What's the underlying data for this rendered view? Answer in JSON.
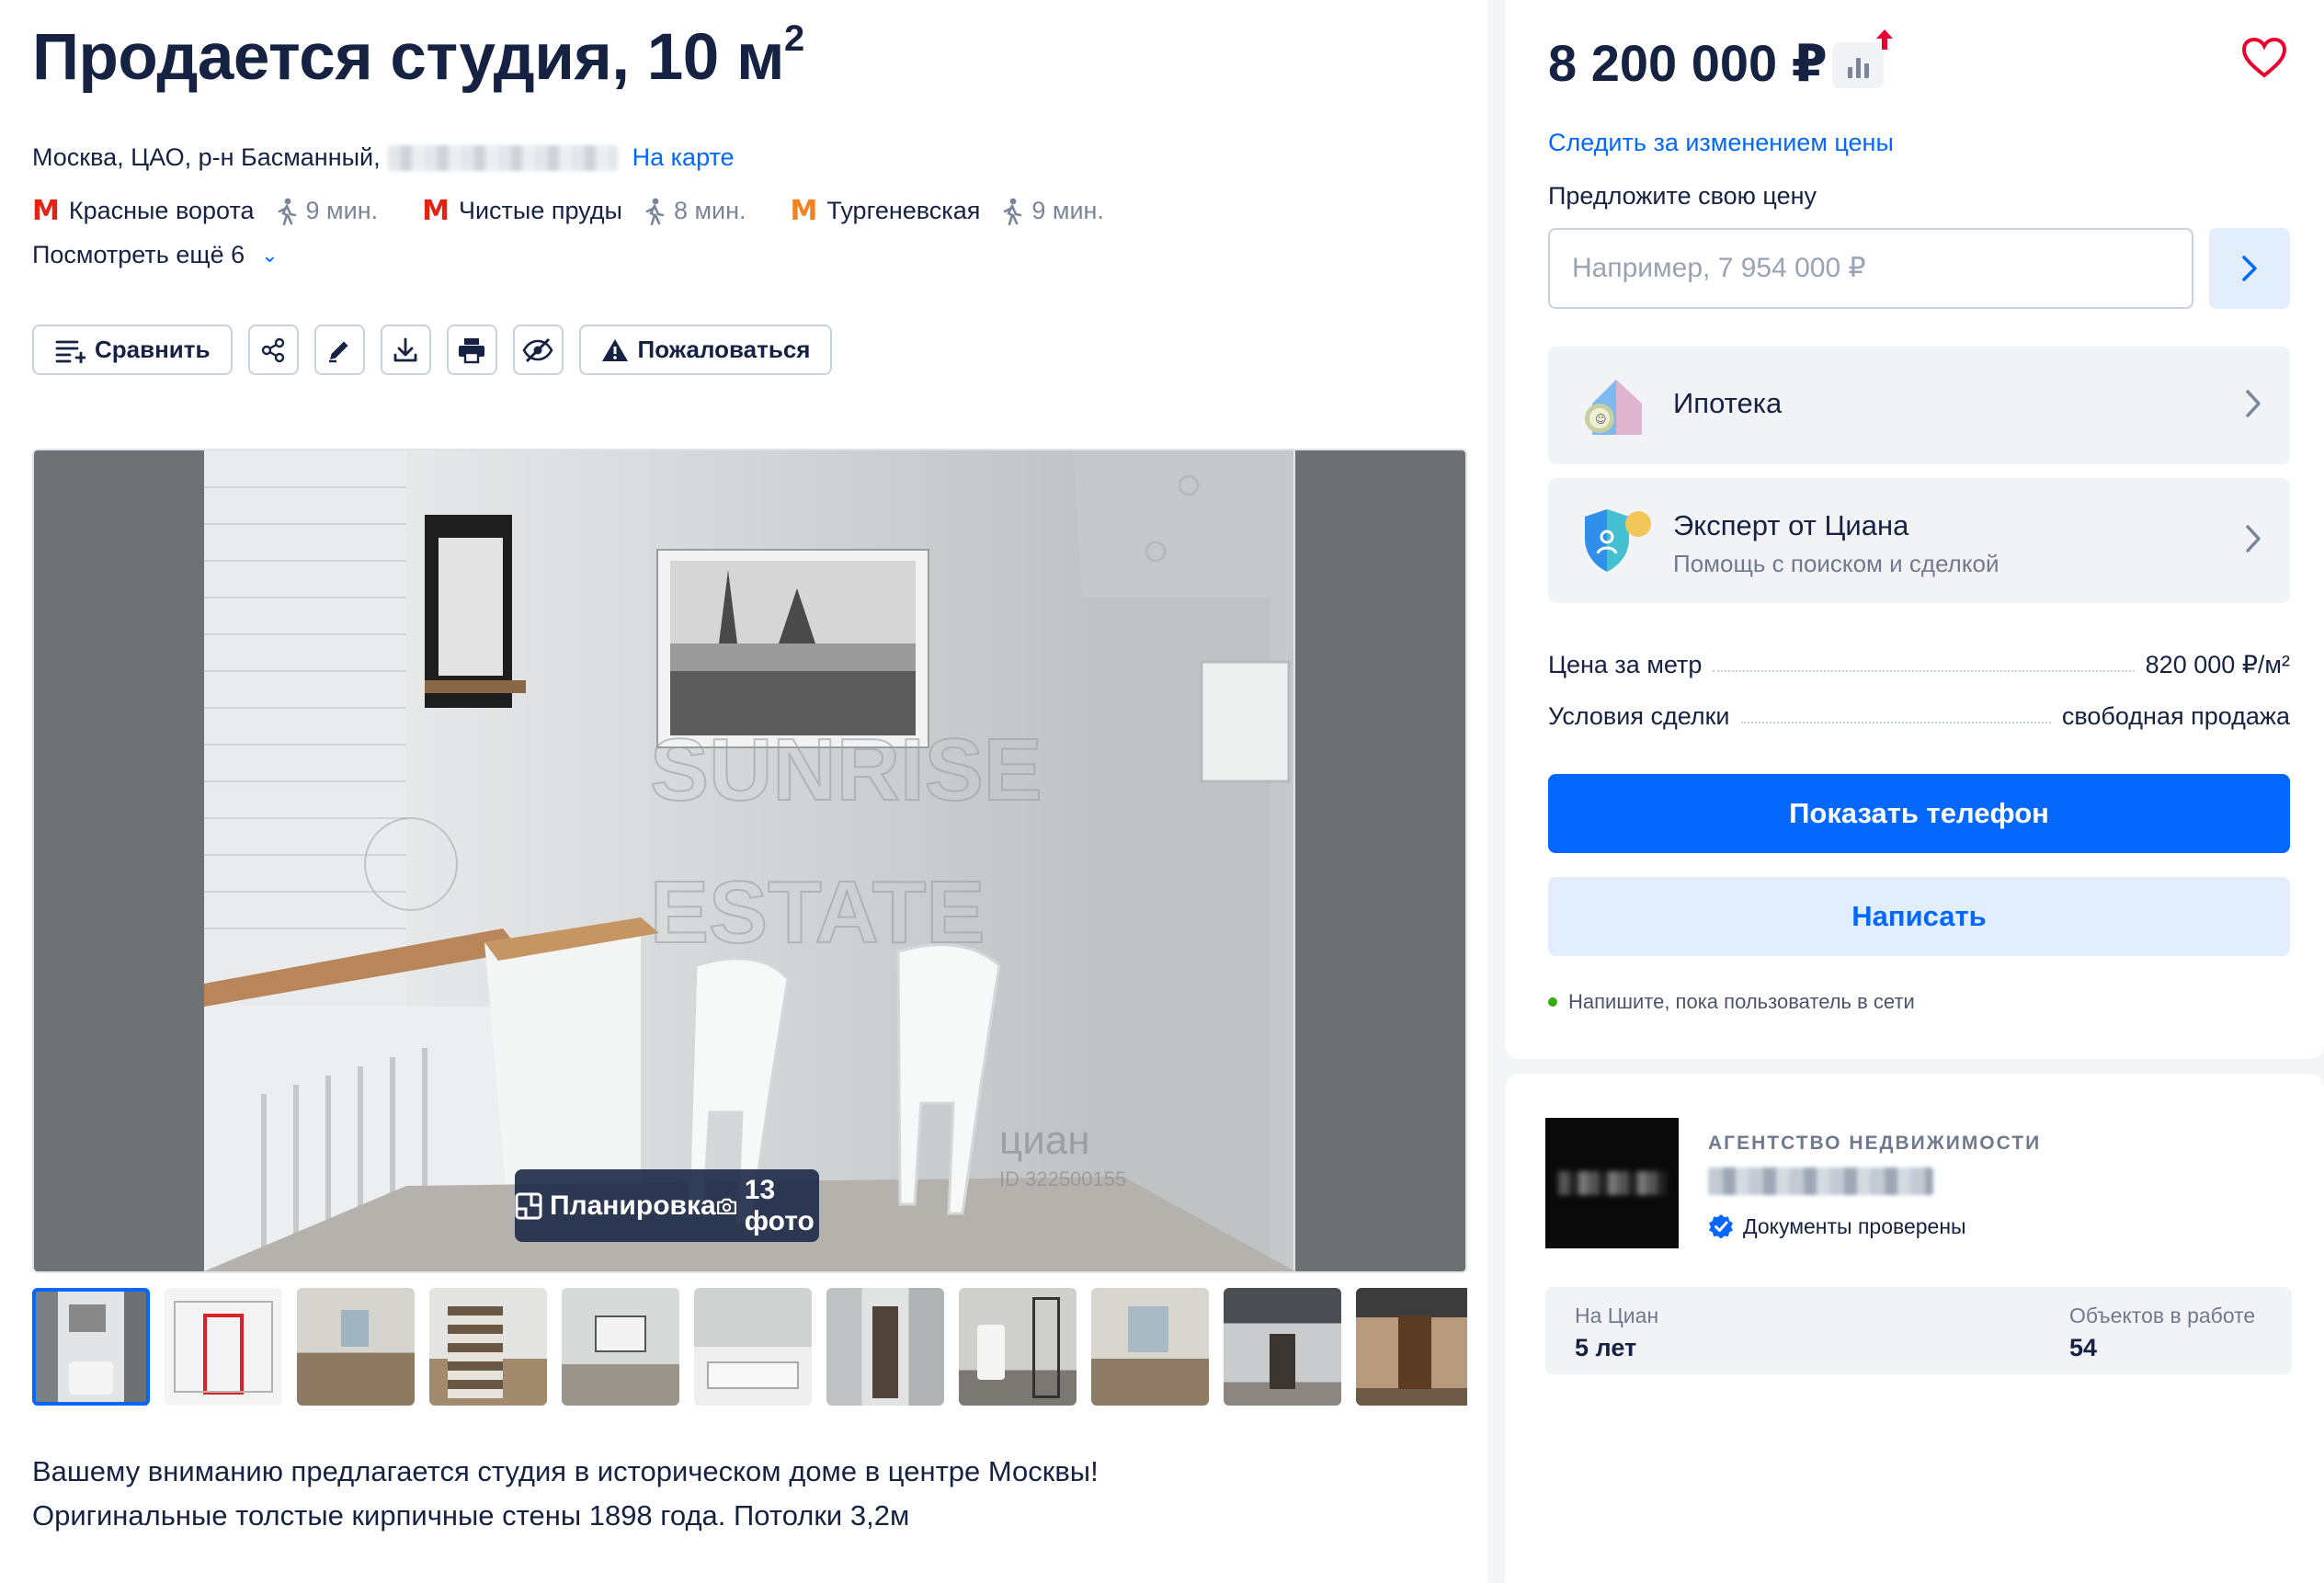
{
  "listing": {
    "title": "Продается студия, 10 м",
    "title_sup": "2",
    "address": "Москва, ЦАО, р-н Басманный,",
    "map_link": "На карте",
    "metros": [
      {
        "name": "Красные ворота",
        "time": "9 мин.",
        "color": "#e42313"
      },
      {
        "name": "Чистые пруды",
        "time": "8 мин.",
        "color": "#e42313"
      },
      {
        "name": "Тургеневская",
        "time": "9 мин.",
        "color": "#f58220"
      }
    ],
    "more_label": "Посмотреть ещё 6"
  },
  "toolbar": {
    "compare_label": "Сравнить",
    "complain_label": "Пожаловаться",
    "icons": [
      "share-icon",
      "edit-icon",
      "download-icon",
      "print-icon",
      "hide-icon"
    ]
  },
  "gallery": {
    "watermark_text_1": "SUNRISE",
    "watermark_text_2": "ESTATE",
    "cian_watermark": "циан",
    "cian_id": "ID 322500155",
    "layout_label": "Планировка",
    "photos_label": "13 фото",
    "thumb_count": 11
  },
  "description": {
    "line1": "Вашему вниманию предлагается студия в историческом доме в центре Москвы!",
    "line2": "Оригинальные толстые кирпичные стены 1898 года. Потолки 3,2м"
  },
  "price_card": {
    "price": "8 200 000 ₽",
    "watch_label": "Следить за изменением цены",
    "offer_label": "Предложите свою цену",
    "offer_placeholder": "Например, 7 954 000 ₽",
    "mortgage_label": "Ипотека",
    "expert_title": "Эксперт от Циана",
    "expert_sub": "Помощь с поиском и сделкой",
    "price_per_meter_key": "Цена за метр",
    "price_per_meter_value": "820 000 ₽/м²",
    "deal_terms_key": "Условия сделки",
    "deal_terms_value": "свободная продажа",
    "show_phone": "Показать телефон",
    "write": "Написать",
    "online_note": "Напишите, пока пользователь в сети"
  },
  "agent": {
    "type": "АГЕНТСТВО НЕДВИЖИМОСТИ",
    "verified": "Документы проверены",
    "on_cian_label": "На Циан",
    "on_cian_value": "5 лет",
    "objects_label": "Объектов в работе",
    "objects_value": "54"
  },
  "colors": {
    "accent": "#0468ff",
    "text": "#152242",
    "muted": "#707a8f",
    "heart": "#e8002e"
  }
}
